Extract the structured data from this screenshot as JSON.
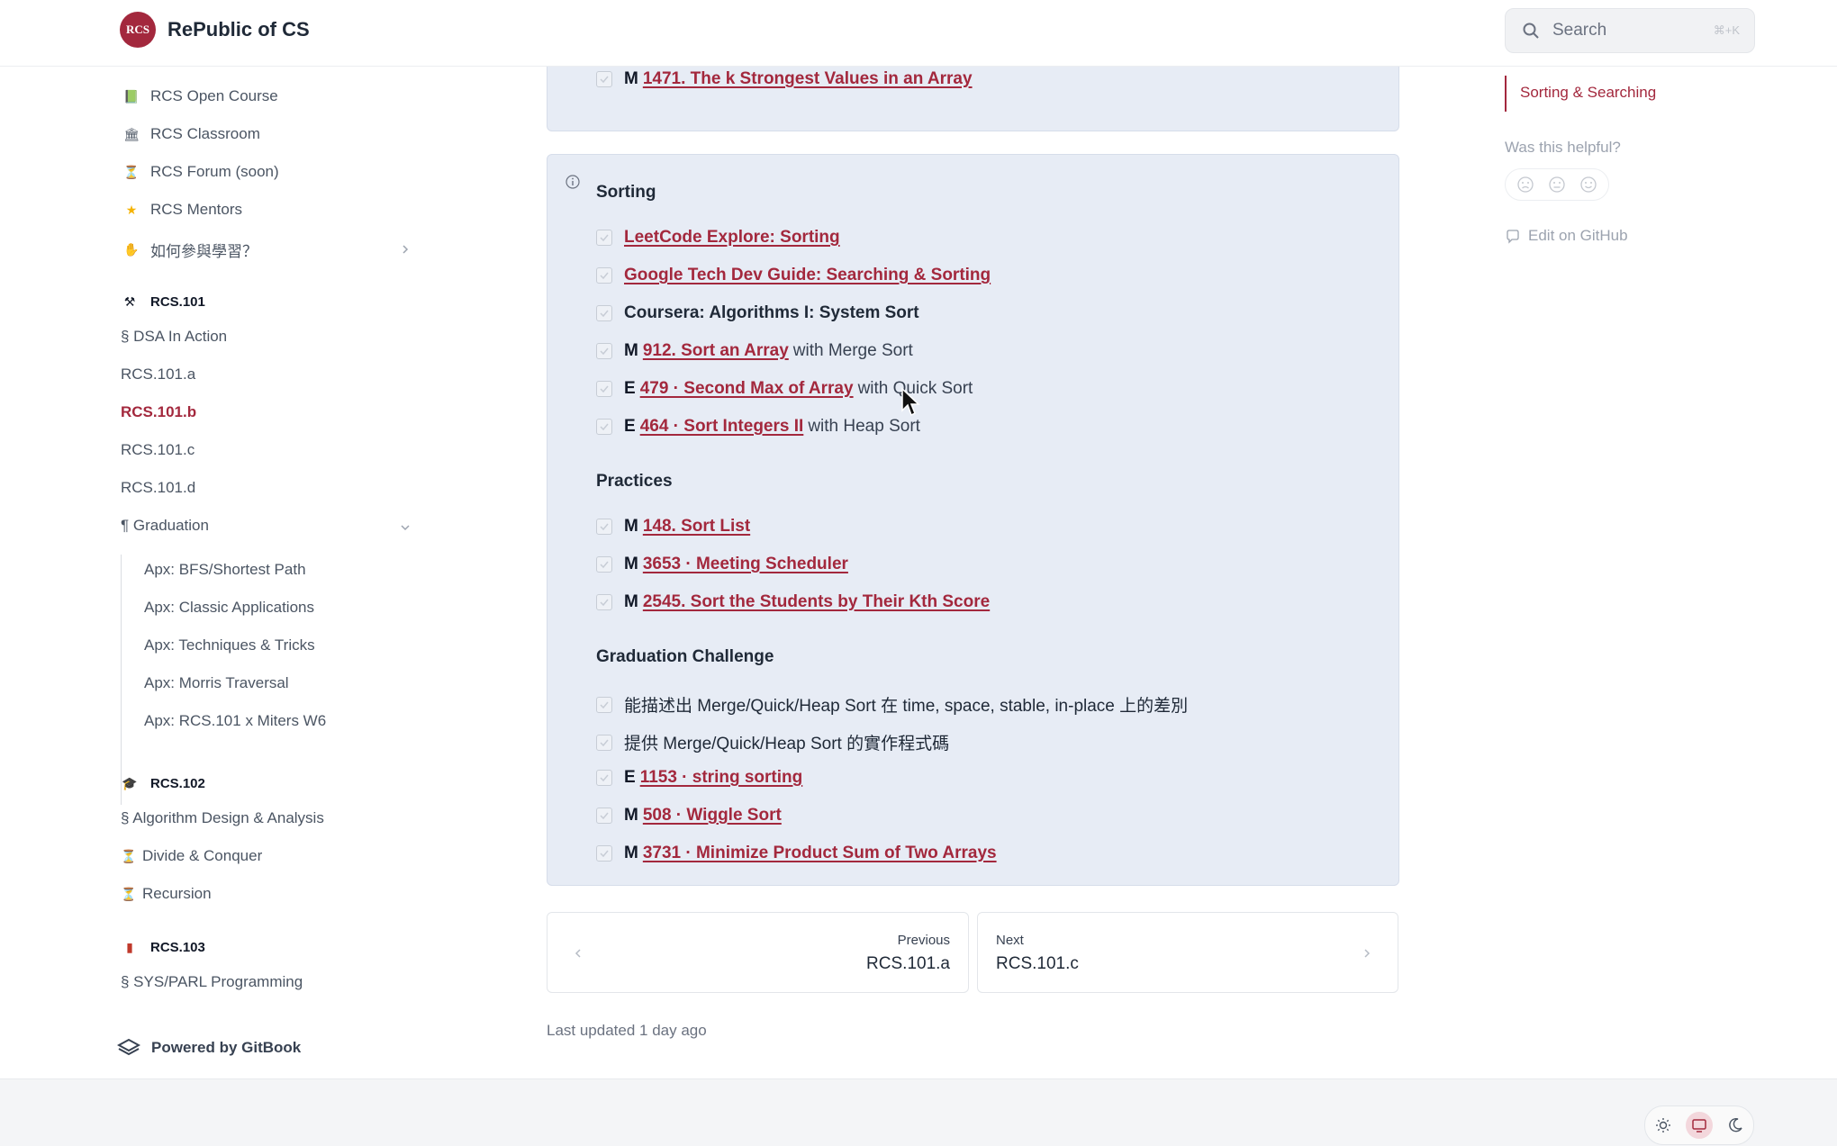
{
  "header": {
    "logo_text": "RCS",
    "brand": "RePublic of CS",
    "search": {
      "placeholder": "Search",
      "shortcut": "⌘+K"
    }
  },
  "sidebar": {
    "top_items": [
      {
        "label": "RCS Open Course",
        "icon": "book-icon"
      },
      {
        "label": "RCS Classroom",
        "icon": "classroom-icon"
      },
      {
        "label": "RCS Forum (soon)",
        "icon": "hourglass-icon"
      },
      {
        "label": "RCS Mentors",
        "icon": "star-icon"
      },
      {
        "label": "如何參與學習？",
        "icon": "hand-icon"
      }
    ],
    "rcs101": {
      "heading": "RCS.101",
      "items": [
        "§ DSA In Action",
        "RCS.101.a",
        "RCS.101.b",
        "RCS.101.c",
        "RCS.101.d",
        "¶ Graduation"
      ],
      "sub_items": [
        "Apx: BFS/Shortest Path",
        "Apx: Classic Applications",
        "Apx: Techniques & Tricks",
        "Apx: Morris Traversal",
        "Apx: RCS.101 x Miters W6"
      ]
    },
    "rcs102": {
      "heading": "RCS.102",
      "items": [
        "§ Algorithm Design & Analysis",
        "Divide & Conquer",
        "Recursion"
      ]
    },
    "rcs103": {
      "heading": "RCS.103",
      "items": [
        "§ SYS/PARL Programming"
      ]
    },
    "powered_by": "Powered by GitBook"
  },
  "main": {
    "top_card_rows": [
      {
        "level": "M",
        "link": "1471. The k Strongest Values in an Array",
        "rest": ""
      }
    ],
    "sorting": {
      "title": "Sorting",
      "rows": [
        {
          "level": "",
          "link": "LeetCode Explore: Sorting",
          "rest": ""
        },
        {
          "level": "",
          "link": "Google Tech Dev Guide: Searching & Sorting",
          "rest": ""
        },
        {
          "level": "",
          "plain": "Coursera: Algorithms I: System Sort"
        },
        {
          "level": "M",
          "link": "912. Sort an Array",
          "rest": "with Merge Sort"
        },
        {
          "level": "E",
          "link": "479 · Second Max of Array",
          "rest": "with Quick Sort"
        },
        {
          "level": "E",
          "link": "464 · Sort Integers II",
          "rest": "with Heap Sort"
        }
      ]
    },
    "practices": {
      "title": "Practices",
      "rows": [
        {
          "level": "M",
          "link": "148. Sort List"
        },
        {
          "level": "M",
          "link": "3653 · Meeting Scheduler"
        },
        {
          "level": "M",
          "link": "2545. Sort the Students by Their Kth Score"
        }
      ]
    },
    "graduation": {
      "title": "Graduation Challenge",
      "rows": [
        {
          "text": "能描述出 Merge/Quick/Heap Sort 在 time, space, stable, in-place 上的差別"
        },
        {
          "text": "提供 Merge/Quick/Heap Sort 的實作程式碼"
        },
        {
          "level": "E",
          "link": "1153 · string sorting"
        },
        {
          "level": "M",
          "link": "508 · Wiggle Sort"
        },
        {
          "level": "M",
          "link": "3731 · Minimize Product Sum of Two Arrays"
        }
      ]
    },
    "prev": {
      "label": "Previous",
      "title": "RCS.101.a"
    },
    "next": {
      "label": "Next",
      "title": "RCS.101.c"
    },
    "last_updated": "Last updated 1 day ago"
  },
  "toc": {
    "active": "Sorting & Searching",
    "helpful": "Was this helpful?",
    "edit": "Edit on GitHub"
  },
  "colors": {
    "accent": "#a3283d",
    "card_bg": "#e7ecf5"
  }
}
